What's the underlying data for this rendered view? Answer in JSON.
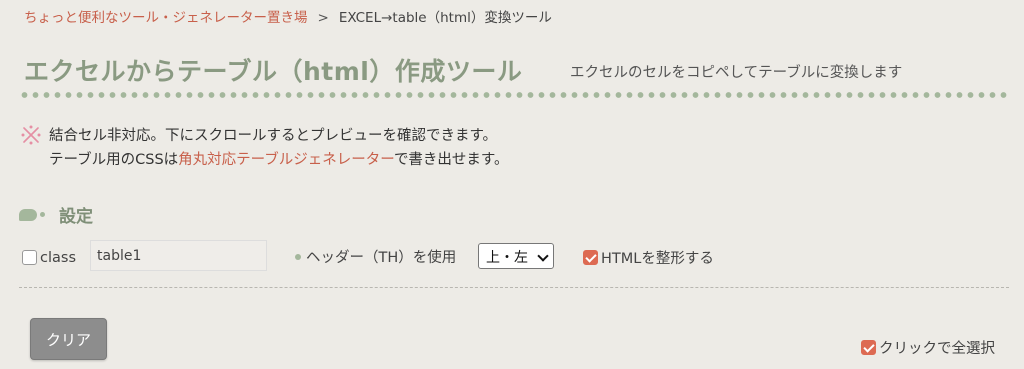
{
  "breadcrumb": {
    "home": "ちょっと便利なツール・ジェネレーター置き場",
    "separator": ">",
    "current": "EXCEL→table（html）変換ツール"
  },
  "header": {
    "title": "エクセルからテーブル（html）作成ツール",
    "subtitle": "エクセルのセルをコピペしてテーブルに変換します"
  },
  "note": {
    "icon": "asterisk-mark-icon",
    "line1": "結合セル非対応。下にスクロールするとプレビューを確認できます。",
    "line2_prefix": "テーブル用のCSSは",
    "line2_link": "角丸対応テーブルジェネレーター",
    "line2_suffix": "で書き出せます。"
  },
  "settings": {
    "title": "設定",
    "class_label": "class",
    "class_checked": false,
    "class_value": "table1",
    "header_label": "ヘッダー（TH）を使用",
    "header_select_value": "上・左",
    "format_label": "HTMLを整形する",
    "format_checked": true
  },
  "actions": {
    "clear_label": "クリア",
    "select_all_label": "クリックで全選択",
    "select_all_checked": true
  },
  "colors": {
    "accent": "#dd6a52",
    "link": "#c8604b",
    "green": "#a4b79c",
    "title": "#8a9a82",
    "background": "#edebe6"
  }
}
